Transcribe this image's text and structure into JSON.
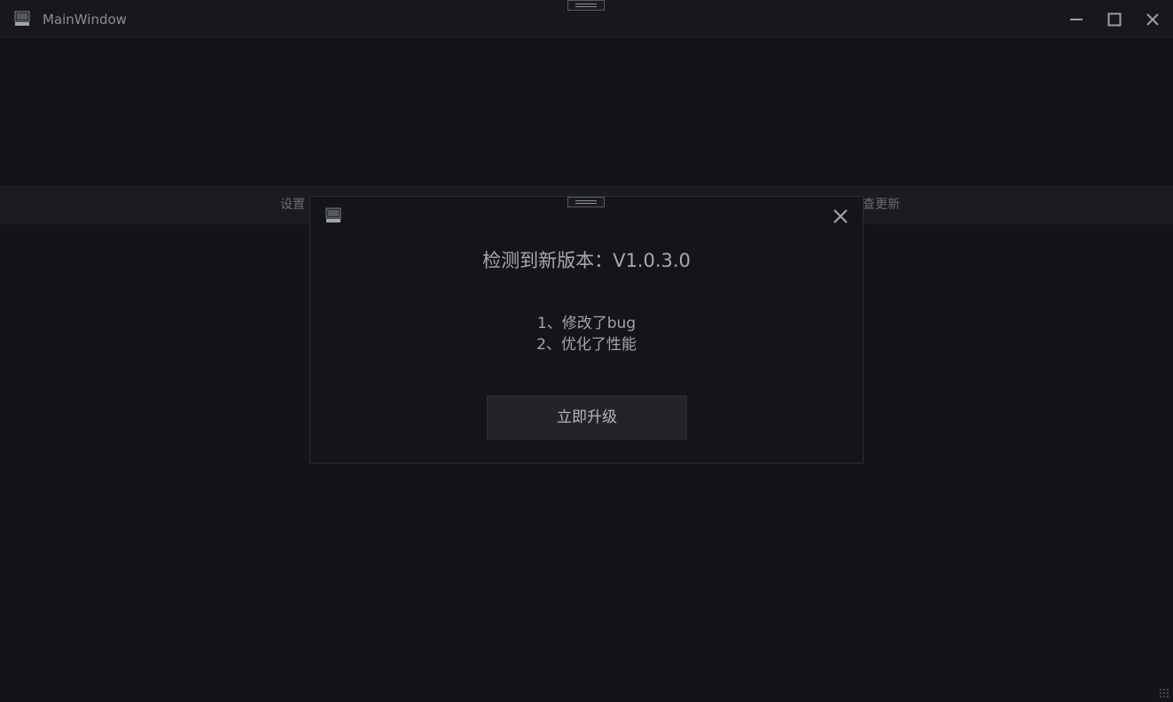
{
  "window": {
    "title": "MainWindow"
  },
  "menu": {
    "settings_label": "设置",
    "check_update_label": "查更新"
  },
  "dialog": {
    "title": "检测到新版本：V1.0.3.0",
    "notes": [
      "1、修改了bug",
      "2、优化了性能"
    ],
    "upgrade_label": "立即升级"
  },
  "icons": {
    "app": "app-icon",
    "minimize": "minimize-icon",
    "maximize": "maximize-icon",
    "close": "close-icon",
    "drag": "drag-grip-icon"
  },
  "colors": {
    "background": "#131418",
    "titlebar": "#17181c",
    "menu_strip": "#1b1c20",
    "dialog": "#141519",
    "button": "#22242a",
    "text_primary": "#a7a9ae"
  }
}
